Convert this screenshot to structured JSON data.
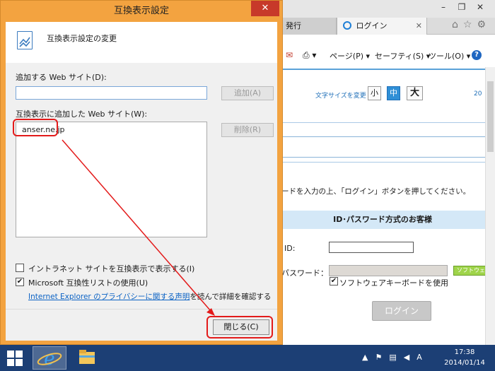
{
  "browser": {
    "tabs": [
      {
        "label": "発行"
      },
      {
        "label": "ログイン"
      }
    ],
    "commands": {
      "page": "ページ(P) ▾",
      "safety": "セーフティ(S) ▾",
      "tools": "ツール(O) ▾"
    },
    "content": {
      "font_size_label": "文字サイズを変更",
      "font_small": "小",
      "font_medium": "中",
      "font_large": "大",
      "year_fragment": "20",
      "instruction": "ードを入力の上、「ログイン」ボタンを押してください。",
      "panel_title": "ID･パスワード方式のお客様",
      "id_label": "ID:",
      "password_label": "パスワード：",
      "softkb_button": "ソフトウェ",
      "softkb_checkbox_label": "ソフトウェアキーボードを使用",
      "login_button": "ログイン"
    }
  },
  "dialog": {
    "title": "互換表示設定",
    "close_symbol": "✕",
    "header": "互換表示設定の変更",
    "add_site_label": "追加する Web サイト(D):",
    "add_site_value": "",
    "add_button": "追加(A)",
    "added_sites_label": "互換表示に追加した Web サイト(W):",
    "added_sites": [
      "anser.ne.jp"
    ],
    "remove_button": "削除(R)",
    "intranet_checkbox": {
      "label": "イントラネット サイトを互換表示で表示する(I)",
      "checked": false
    },
    "ms_list_checkbox": {
      "label": "Microsoft 互換性リストの使用(U)",
      "checked": true
    },
    "privacy_link": "Internet Explorer のプライバシーに関する声明",
    "privacy_suffix": "を読んで詳細を確認する",
    "close_button": "閉じる(C)"
  },
  "taskbar": {
    "time": "17:38",
    "date": "2014/01/14",
    "ime": "A"
  },
  "colors": {
    "annotation": "#e31b1b",
    "dialog_frame": "#f3a340",
    "taskbar": "#1c3f75",
    "link": "#0b62c4"
  }
}
